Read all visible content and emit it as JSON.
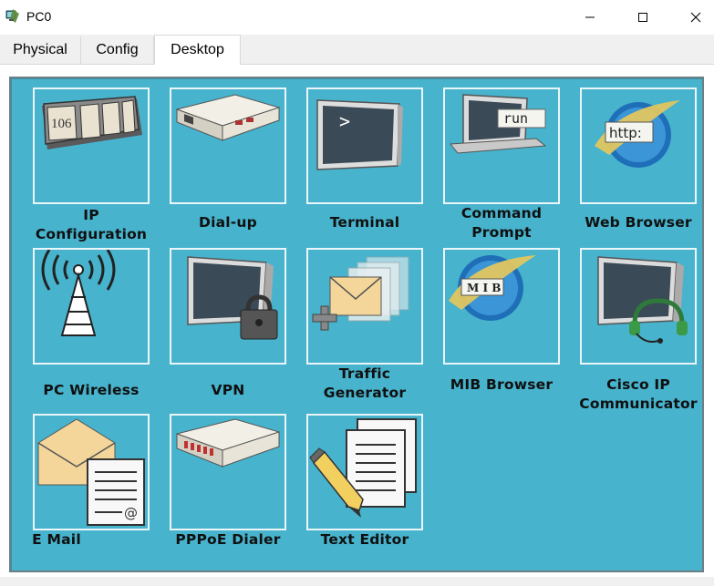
{
  "window": {
    "title": "PC0",
    "app_icon": "pc-device-icon",
    "controls": [
      "minimize-icon",
      "maximize-icon",
      "close-icon"
    ]
  },
  "tabs": [
    {
      "label": "Physical",
      "selected": false
    },
    {
      "label": "Config",
      "selected": false
    },
    {
      "label": "Desktop",
      "selected": true
    }
  ],
  "desktop": {
    "background_color": "#47b3cd",
    "apps": [
      {
        "label": "IP Configuration",
        "icon": "ip-configuration-icon"
      },
      {
        "label": "Dial-up",
        "icon": "modem-icon"
      },
      {
        "label": "Terminal",
        "icon": "terminal-icon"
      },
      {
        "label": "Command Prompt",
        "icon": "command-prompt-icon"
      },
      {
        "label": "Web Browser",
        "icon": "web-browser-icon"
      },
      {
        "label": "PC Wireless",
        "icon": "wireless-antenna-icon"
      },
      {
        "label": "VPN",
        "icon": "vpn-lock-icon"
      },
      {
        "label": "Traffic Generator",
        "icon": "traffic-generator-icon"
      },
      {
        "label": "MIB Browser",
        "icon": "mib-browser-icon"
      },
      {
        "label": "Cisco IP Communicator",
        "icon": "ip-communicator-headset-icon"
      },
      {
        "label": "E Mail",
        "icon": "email-icon"
      },
      {
        "label": "PPPoE Dialer",
        "icon": "pppoe-dialer-icon"
      },
      {
        "label": "Text Editor",
        "icon": "text-editor-icon"
      }
    ],
    "icon_texts": {
      "ip_config_display": "106",
      "command_prompt_badge": "run",
      "web_browser_badge": "http:",
      "mib_badge": "M I B"
    }
  }
}
